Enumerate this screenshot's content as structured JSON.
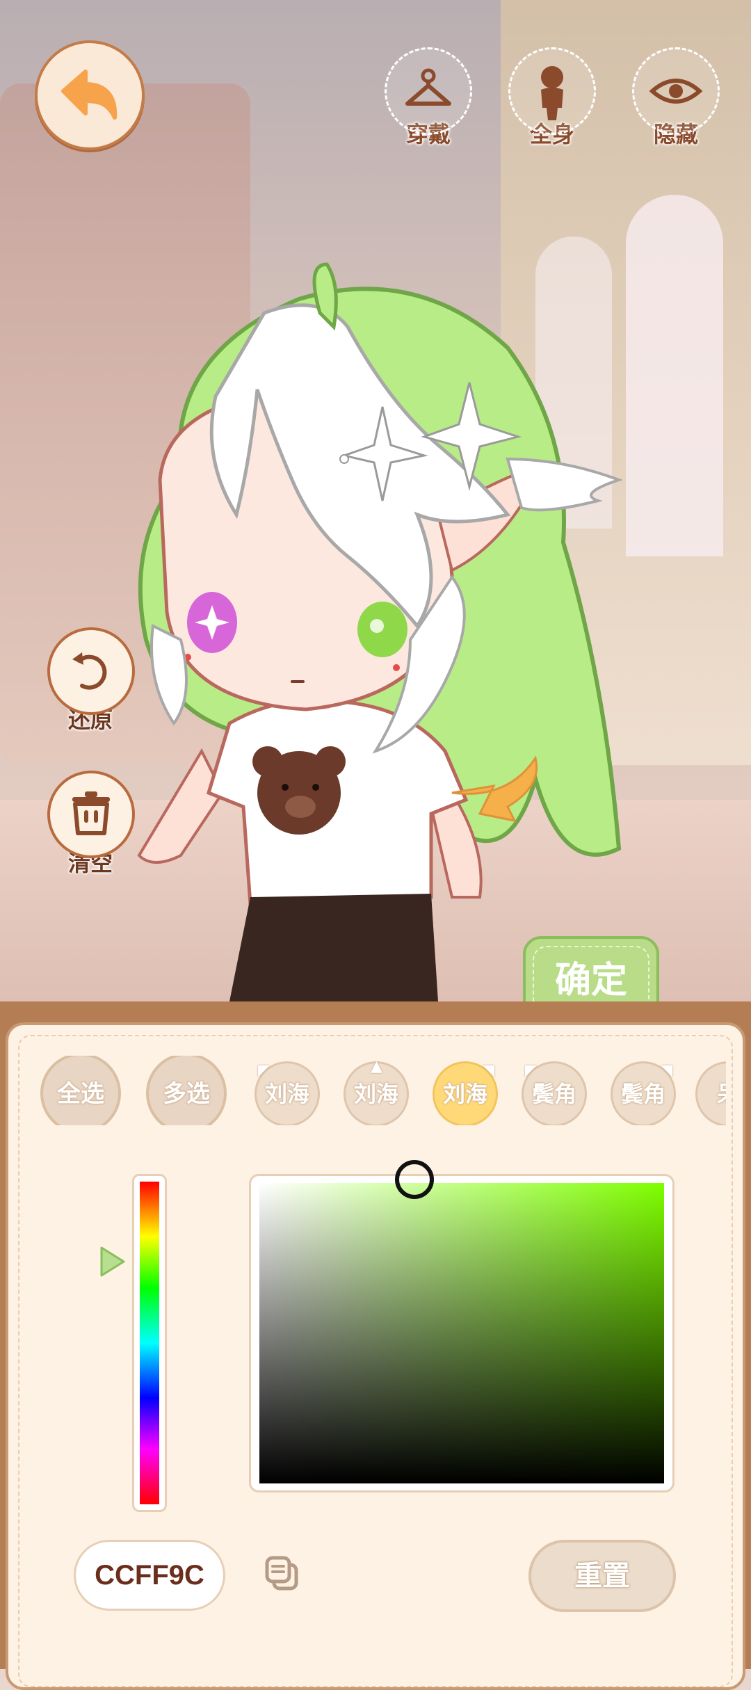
{
  "top_tools": [
    {
      "icon": "hanger-icon",
      "label": "穿戴"
    },
    {
      "icon": "full-body-icon",
      "label": "全身"
    },
    {
      "icon": "eye-icon",
      "label": "隐藏"
    }
  ],
  "side_tools": [
    {
      "icon": "restore-icon",
      "label": "还原"
    },
    {
      "icon": "trash-icon",
      "label": "清空"
    }
  ],
  "confirm_label": "确定",
  "chips": {
    "select_all": "全选",
    "multi_select": "多选",
    "items": [
      "刘海",
      "刘海",
      "刘海",
      "鬓角",
      "鬓角",
      "呆"
    ],
    "active_index": 2
  },
  "color": {
    "hex": "CCFF9C",
    "hue_color": "#7fff00"
  },
  "reset_label": "重置",
  "colors": {
    "accent_brown": "#b86b3e",
    "confirm_green": "#b8dc88",
    "active_chip": "#ffd978",
    "panel_bg": "#fdf2e4"
  }
}
